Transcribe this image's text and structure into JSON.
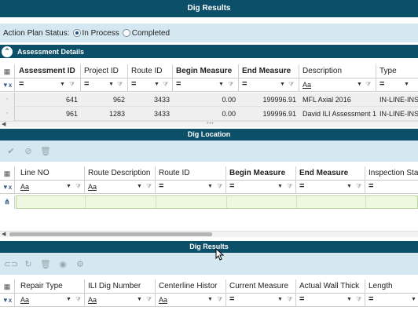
{
  "app": {
    "title": "Dig Results"
  },
  "status": {
    "label": "Action Plan Status:",
    "options": [
      {
        "label": "In Process",
        "selected": true
      },
      {
        "label": "Completed",
        "selected": false
      }
    ]
  },
  "assessment": {
    "section_title": "Assessment Details",
    "collapse_icon": "chevron-up-icon",
    "columns": [
      "Assessment ID",
      "Project ID",
      "Route ID",
      "Begin Measure",
      "End Measure",
      "Description",
      "Type"
    ],
    "bold_columns": [
      "Assessment ID",
      "Begin Measure",
      "End Measure"
    ],
    "filter_ops": [
      "=",
      "=",
      "=",
      "=",
      "=",
      "Aa",
      "="
    ],
    "rows": [
      {
        "assessment_id": "641",
        "project_id": "962",
        "route_id": "3433",
        "begin": "0.00",
        "end": "199996.91",
        "description": "MFL Axial 2016",
        "type": "IN-LINE-INS"
      },
      {
        "assessment_id": "961",
        "project_id": "1283",
        "route_id": "3433",
        "begin": "0.00",
        "end": "199996.91",
        "description": "David ILI Assessment 1",
        "type": "IN-LINE-INS"
      }
    ]
  },
  "dig_location": {
    "title": "Dig Location",
    "toolbar": [
      "check-icon",
      "cancel-icon",
      "delete-icon"
    ],
    "columns": [
      "Line NO",
      "Route Description",
      "Route ID",
      "Begin Measure",
      "End Measure",
      "Inspection Start"
    ],
    "bold_columns": [
      "Begin Measure",
      "End Measure"
    ],
    "filter_ops": [
      "Aa",
      "Aa",
      "=",
      "=",
      "=",
      "="
    ]
  },
  "dig_results": {
    "title": "Dig Results",
    "toolbar": [
      "link-icon",
      "refresh-icon",
      "delete-icon",
      "view-icon",
      "settings-icon"
    ],
    "columns": [
      "Repair Type",
      "ILI Dig Number",
      "Centerline Histor",
      "Current Measure",
      "Actual Wall Thick",
      "Length"
    ],
    "filter_ops": [
      "Aa",
      "Aa",
      "Aa",
      "=",
      "=",
      "="
    ]
  },
  "colors": {
    "header_bar": "#0b4f68",
    "light_band": "#d5e8f1",
    "new_row": "#eef7df"
  }
}
